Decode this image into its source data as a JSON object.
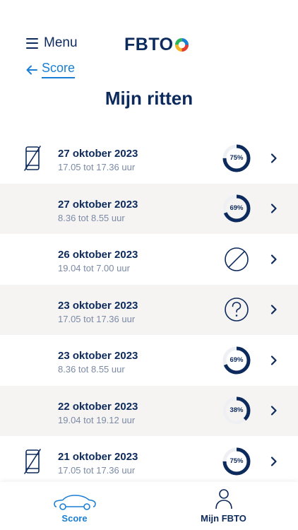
{
  "header": {
    "menu_label": "Menu",
    "logo_text": "FBTO",
    "back_label": "Score"
  },
  "page_title": "Mijn ritten",
  "colors": {
    "navy": "#0d2a5c",
    "accent_blue": "#1a7fd4",
    "muted_text": "#7b8aa5",
    "row_alt": "#f5f4f3"
  },
  "rides": [
    {
      "date": "27 oktober 2023",
      "time": "17.05 tot 17.36 uur",
      "status": "score",
      "score": 75,
      "score_label": "75%",
      "phone_icon": true
    },
    {
      "date": "27 oktober 2023",
      "time": "8.36 tot 8.55 uur",
      "status": "score",
      "score": 69,
      "score_label": "69%",
      "phone_icon": false
    },
    {
      "date": "26 oktober 2023",
      "time": "19.04 tot 7.00 uur",
      "status": "excluded",
      "phone_icon": false
    },
    {
      "date": "23 oktober 2023",
      "time": "17.05 tot 17.36 uur",
      "status": "unknown",
      "phone_icon": false
    },
    {
      "date": "23 oktober 2023",
      "time": "8.36 tot 8.55 uur",
      "status": "score",
      "score": 69,
      "score_label": "69%",
      "phone_icon": false
    },
    {
      "date": "22 oktober 2023",
      "time": "19.04 tot 19.12 uur",
      "status": "score",
      "score": 38,
      "score_label": "38%",
      "phone_icon": false
    },
    {
      "date": "21 oktober 2023",
      "time": "17.05 tot 17.36 uur",
      "status": "score",
      "score": 75,
      "score_label": "75%",
      "phone_icon": true
    }
  ],
  "tabbar": {
    "score_label": "Score",
    "mijn_label": "Mijn FBTO",
    "active": "score"
  }
}
